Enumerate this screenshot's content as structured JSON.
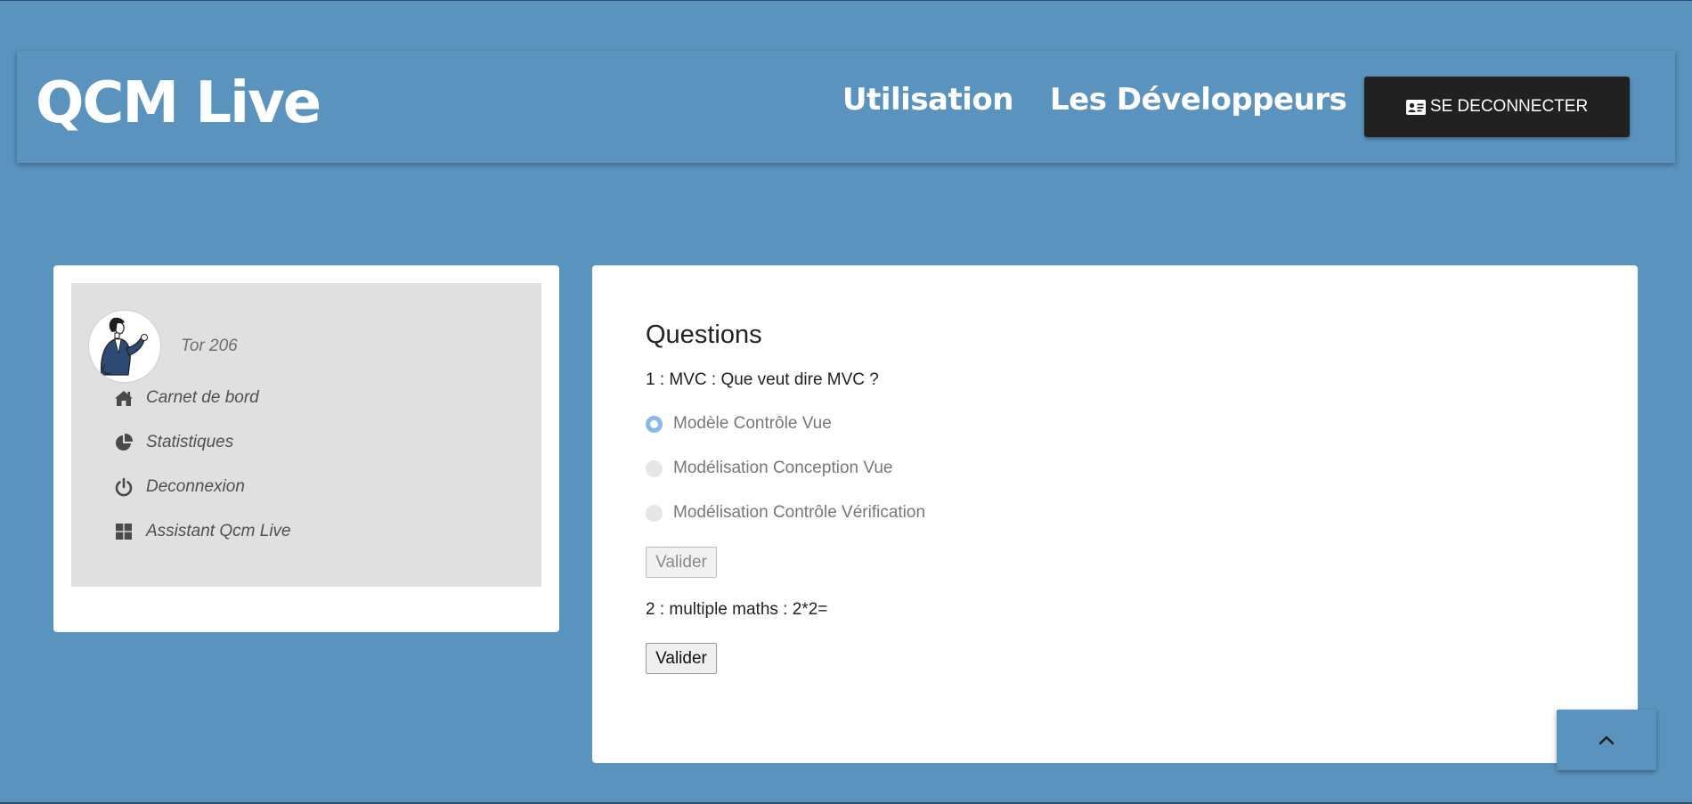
{
  "navbar": {
    "brand": "QCM Live",
    "links": [
      {
        "label": "Utilisation"
      },
      {
        "label": "Les Développeurs"
      }
    ],
    "logout_label": "SE DECONNECTER",
    "logout_icon": "id-card-icon"
  },
  "sidebar": {
    "username": "Tor 206",
    "items": [
      {
        "label": "Carnet de bord",
        "icon": "home-icon"
      },
      {
        "label": "Statistiques",
        "icon": "pie-chart-icon"
      },
      {
        "label": "Deconnexion",
        "icon": "power-icon"
      },
      {
        "label": "Assistant Qcm Live",
        "icon": "windows-icon"
      }
    ]
  },
  "main": {
    "title": "Questions",
    "questions": [
      {
        "text": "1 : MVC : Que veut dire MVC ?",
        "options": [
          {
            "label": "Modèle Contrôle Vue",
            "selected": true
          },
          {
            "label": "Modélisation Conception Vue",
            "selected": false
          },
          {
            "label": "Modélisation Contrôle Vérification",
            "selected": false
          }
        ],
        "button_label": "Valider",
        "button_disabled": true
      },
      {
        "text": "2 : multiple maths : 2*2=",
        "options": [],
        "button_label": "Valider",
        "button_disabled": false
      }
    ]
  },
  "scroll_top_icon": "chevron-up-icon",
  "colors": {
    "background": "#5b93bf",
    "logout_button": "#212121",
    "panel": "#e0e0e0",
    "radio_selected": "#8bb8ea"
  }
}
